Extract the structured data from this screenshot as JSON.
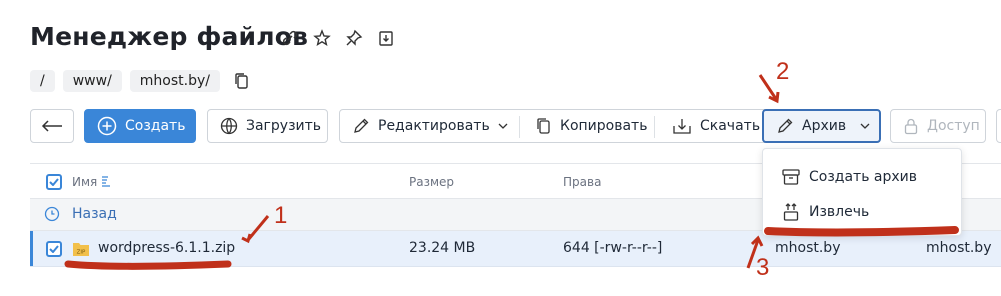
{
  "page": {
    "title": "Менеджер файлов"
  },
  "title_icons": [
    "link-icon",
    "star-icon",
    "pin-icon",
    "download-box-icon"
  ],
  "breadcrumb": {
    "items": [
      "/",
      "www/",
      "mhost.by/"
    ]
  },
  "toolbar": {
    "back_label": "←",
    "create_label": "Создать",
    "upload_label": "Загрузить",
    "edit_label": "Редактировать",
    "copy_label": "Копировать",
    "download_label": "Скачать",
    "archive_label": "Архив",
    "access_label": "Доступ"
  },
  "table": {
    "headers": {
      "name": "Имя",
      "size": "Размер",
      "rights": "Права"
    },
    "back_label": "Назад",
    "rows": [
      {
        "name": "wordpress-6.1.1.zip",
        "icon_label": "ZIP",
        "size": "23.24 MB",
        "rights": "644 [-rw-r--r--]",
        "owner": "mhost.by",
        "group": "mhost.by"
      }
    ]
  },
  "archive_menu": {
    "items": [
      {
        "label": "Создать архив",
        "icon": "archive-box-icon"
      },
      {
        "label": "Извлечь",
        "icon": "extract-icon"
      }
    ]
  },
  "annotations": {
    "step1": "1",
    "step2": "2",
    "step3": "3"
  },
  "colors": {
    "primary": "#3a86d8",
    "annotation": "#c0301a",
    "selected_row": "#e8f0fb"
  }
}
